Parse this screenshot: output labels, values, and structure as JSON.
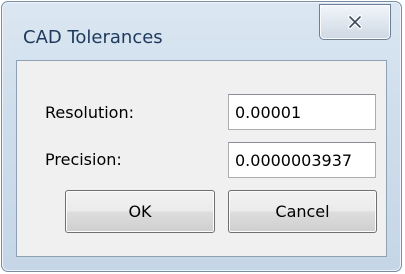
{
  "dialog": {
    "title": "CAD Tolerances",
    "close_icon": "close-x-icon"
  },
  "fields": {
    "resolution_label": "Resolution:",
    "resolution_value": "0.00001",
    "precision_label": "Precision:",
    "precision_value": "0.0000003937"
  },
  "buttons": {
    "ok_label": "OK",
    "cancel_label": "Cancel"
  }
}
